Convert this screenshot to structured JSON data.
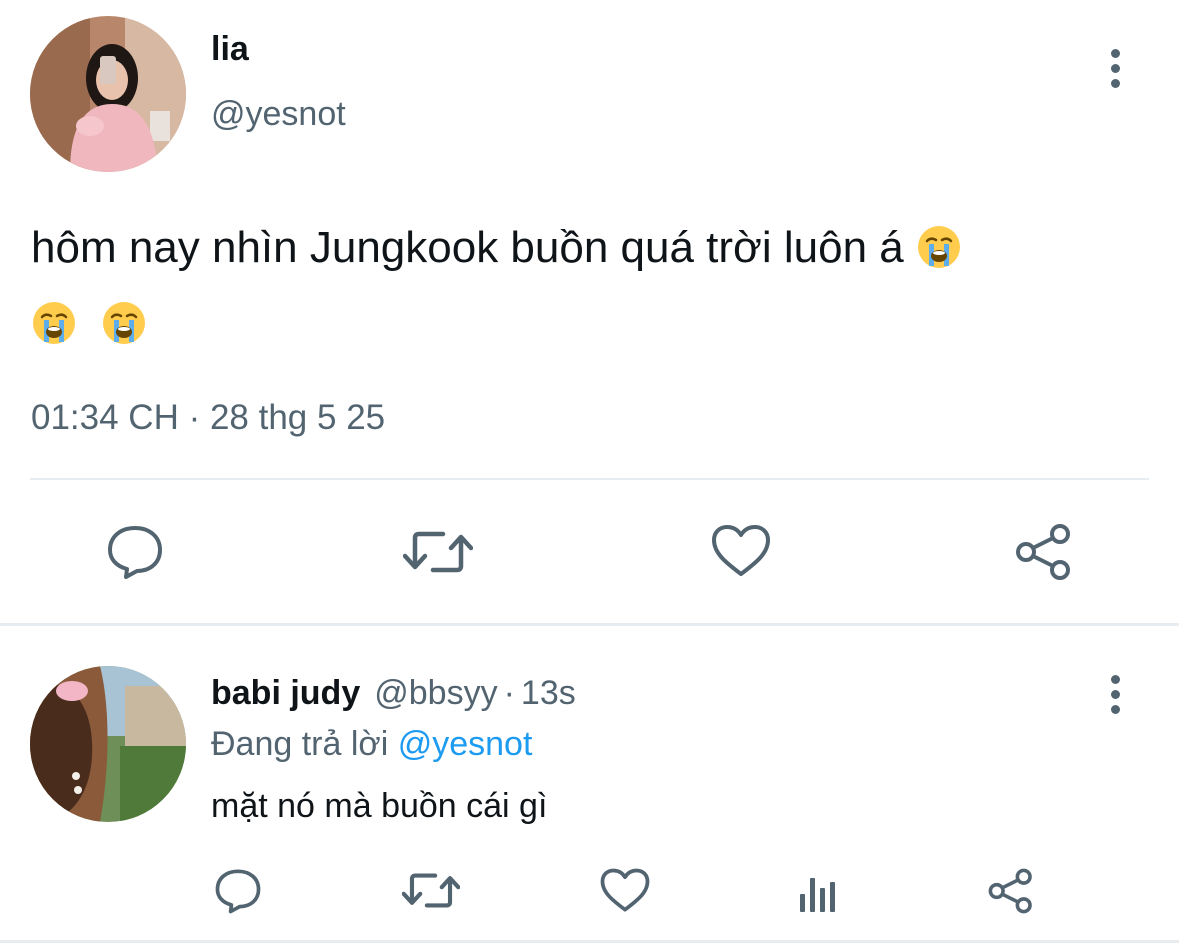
{
  "main_tweet": {
    "name": "lia",
    "handle": "@yesnot",
    "text": "hôm nay nhìn Jungkook buồn quá trời luôn á",
    "timestamp": "01:34 CH · 28 thg 5 25",
    "emoji": "loudly-crying-face"
  },
  "reply": {
    "name": "babi judy",
    "handle": "@bbsyy",
    "separator": "·",
    "time": "13s",
    "replying_prefix": "Đang trả lời",
    "replying_to": "@yesnot",
    "text": "mặt nó mà buồn cái gì"
  },
  "colors": {
    "text_primary": "#0f1419",
    "text_secondary": "#536471",
    "link": "#1d9bf0",
    "divider": "#e6ecf0"
  },
  "icons": {
    "reply": "reply-icon",
    "retweet": "retweet-icon",
    "like": "heart-icon",
    "views": "views-icon",
    "share": "share-icon",
    "more": "more-vertical-icon"
  }
}
